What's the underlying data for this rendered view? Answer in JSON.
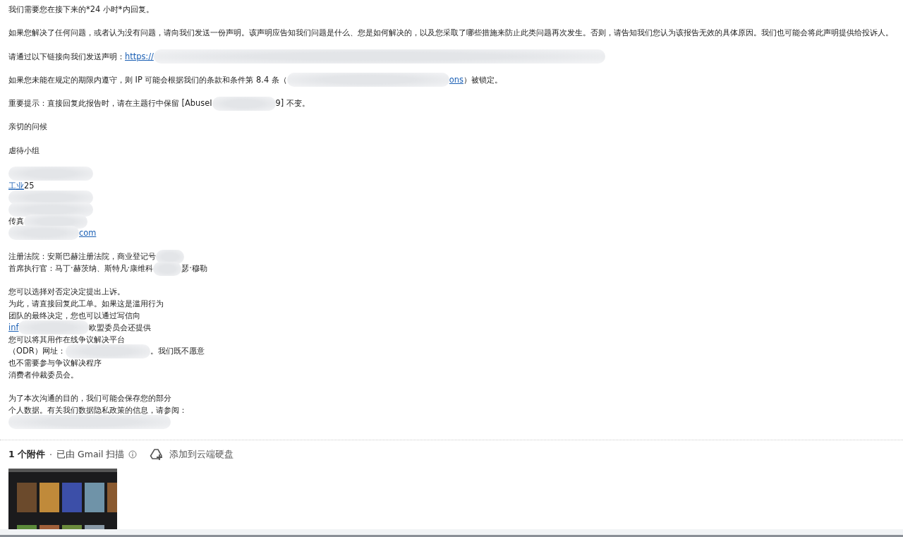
{
  "message": {
    "blocks": [
      {
        "lines": [
          [
            {
              "kind": "text",
              "text": "我们需要您在接下来的*24 小时*内回复。"
            }
          ]
        ]
      },
      {
        "lines": [
          [
            {
              "kind": "text",
              "text": "如果您解决了任何问题，或者认为没有问题，请向我们发送一份声明。该声明应告知我们问题是什么、您是如何解决的，以及您采取了哪些措施来防止此类问题再次发生。否则，请告知我们您认为该报告无效的具体原因。我们也可能会将此声明提供给投诉人。"
            }
          ]
        ]
      },
      {
        "lines": [
          [
            {
              "kind": "text",
              "text": "请通过以下链接向我们发送声明："
            },
            {
              "kind": "link",
              "text": "https://"
            },
            {
              "kind": "redacted"
            }
          ]
        ]
      },
      {
        "lines": [
          [
            {
              "kind": "text",
              "text": "如果您未能在规定的期限内遵守，则 IP 可能会根据我们的条款和条件第 8.4 条（"
            },
            {
              "kind": "redacted"
            },
            {
              "kind": "link",
              "text": "ons"
            },
            {
              "kind": "text",
              "text": "）被锁定。"
            }
          ]
        ]
      },
      {
        "lines": [
          [
            {
              "kind": "text",
              "text": "重要提示：直接回复此报告时，请在主题行中保留 [AbuseI"
            },
            {
              "kind": "redacted"
            },
            {
              "kind": "text",
              "text": "9] 不变。"
            }
          ]
        ]
      },
      {
        "lines": [
          [
            {
              "kind": "text",
              "text": "亲切的问候"
            }
          ]
        ]
      },
      {
        "lines": [
          [
            {
              "kind": "text",
              "text": "虐待小组"
            }
          ]
        ]
      },
      {
        "lines": [
          [
            {
              "kind": "redacted"
            }
          ],
          [
            {
              "kind": "link",
              "text": "工业"
            },
            {
              "kind": "text",
              "text": " 25"
            }
          ],
          [
            {
              "kind": "redacted"
            }
          ],
          [
            {
              "kind": "redacted"
            }
          ],
          [
            {
              "kind": "text",
              "text": "传真"
            },
            {
              "kind": "redacted"
            }
          ],
          [
            {
              "kind": "redacted"
            },
            {
              "kind": "link",
              "text": "com"
            }
          ]
        ]
      },
      {
        "lines": [
          [
            {
              "kind": "text",
              "text": "注册法院：安斯巴赫注册法院，商业登记号"
            },
            {
              "kind": "redacted"
            }
          ],
          [
            {
              "kind": "text",
              "text": "首席执行官：马丁·赫茨纳、斯特凡·康维科"
            },
            {
              "kind": "redacted"
            },
            {
              "kind": "text",
              "text": "瑟·穆勒"
            }
          ]
        ]
      },
      {
        "lines": [
          [
            {
              "kind": "text",
              "text": "您可以选择对否定决定提出上诉。"
            }
          ],
          [
            {
              "kind": "text",
              "text": "为此，请直接回复此工单。如果这是滥用行为"
            }
          ],
          [
            {
              "kind": "text",
              "text": "团队的最终决定，您也可以通过写信向"
            }
          ],
          [
            {
              "kind": "link",
              "text": "inf"
            },
            {
              "kind": "redacted"
            },
            {
              "kind": "text",
              "text": "欧盟委员会还提供"
            }
          ],
          [
            {
              "kind": "text",
              "text": "您可以将其用作在线争议解决平台"
            }
          ],
          [
            {
              "kind": "text",
              "text": "（ODR）网址："
            },
            {
              "kind": "redacted"
            },
            {
              "kind": "text",
              "text": "。我们既不愿意"
            }
          ],
          [
            {
              "kind": "text",
              "text": "也不需要参与争议解决程序"
            }
          ],
          [
            {
              "kind": "text",
              "text": "消费者仲裁委员会。"
            }
          ]
        ]
      },
      {
        "lines": [
          [
            {
              "kind": "text",
              "text": "为了本次沟通的目的，我们可能会保存您的部分"
            }
          ],
          [
            {
              "kind": "text",
              "text": "个人数据。有关我们数据隐私政策的信息，请参阅："
            }
          ],
          [
            {
              "kind": "redacted"
            }
          ]
        ]
      }
    ]
  },
  "attachments": {
    "count": "1 个附件",
    "separator": "·",
    "scan_note": "已由 Gmail 扫描",
    "drive_action": "添加到云端硬盘"
  }
}
